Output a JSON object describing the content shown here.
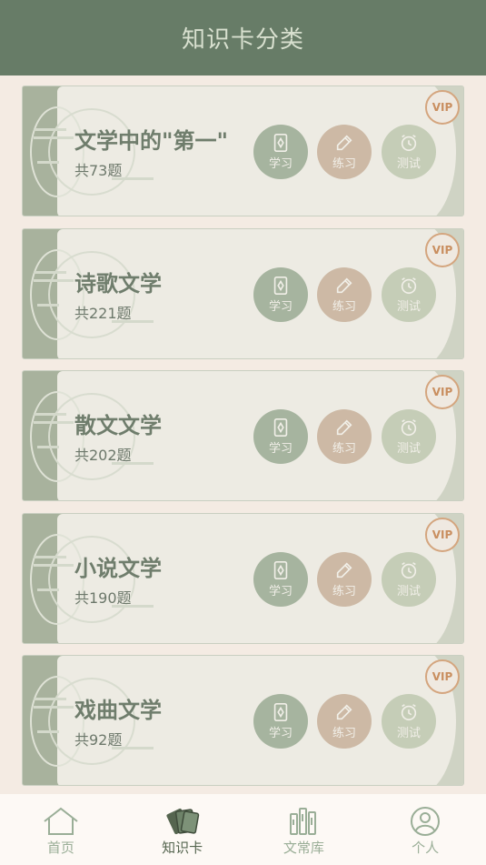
{
  "header": {
    "title": "知识卡分类"
  },
  "cards": [
    {
      "title": "文学中的\"第一\"",
      "count": "共73题",
      "vip": "VIP"
    },
    {
      "title": "诗歌文学",
      "count": "共221题",
      "vip": "VIP"
    },
    {
      "title": "散文文学",
      "count": "共202题",
      "vip": "VIP"
    },
    {
      "title": "小说文学",
      "count": "共190题",
      "vip": "VIP"
    },
    {
      "title": "戏曲文学",
      "count": "共92题",
      "vip": "VIP"
    }
  ],
  "buttons": {
    "study": "学习",
    "practice": "练习",
    "test": "测试"
  },
  "tabs": [
    {
      "label": "首页",
      "icon": "home-icon"
    },
    {
      "label": "知识卡",
      "icon": "cards-icon",
      "active": true
    },
    {
      "label": "文常库",
      "icon": "books-icon"
    },
    {
      "label": "个人",
      "icon": "user-icon"
    }
  ],
  "colors": {
    "header_bg": "#677c67",
    "study_btn": "#a6b49f",
    "practice_btn": "#cdb9a5",
    "test_btn": "#c5cdb7",
    "vip": "#c98e5f"
  }
}
